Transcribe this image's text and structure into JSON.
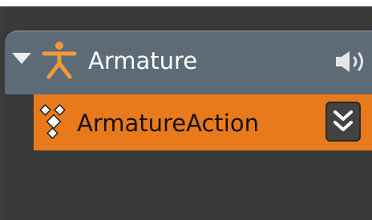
{
  "outliner": {
    "object": {
      "label": "Armature",
      "expanded": true,
      "icon": "armature-icon",
      "speaker_icon": "speaker-icon",
      "row_color": "#5d6b77"
    },
    "action": {
      "label": "ArmatureAction",
      "icon": "action-icon",
      "button_icon": "double-chevron-down-icon",
      "row_color": "#e97a1c"
    }
  }
}
